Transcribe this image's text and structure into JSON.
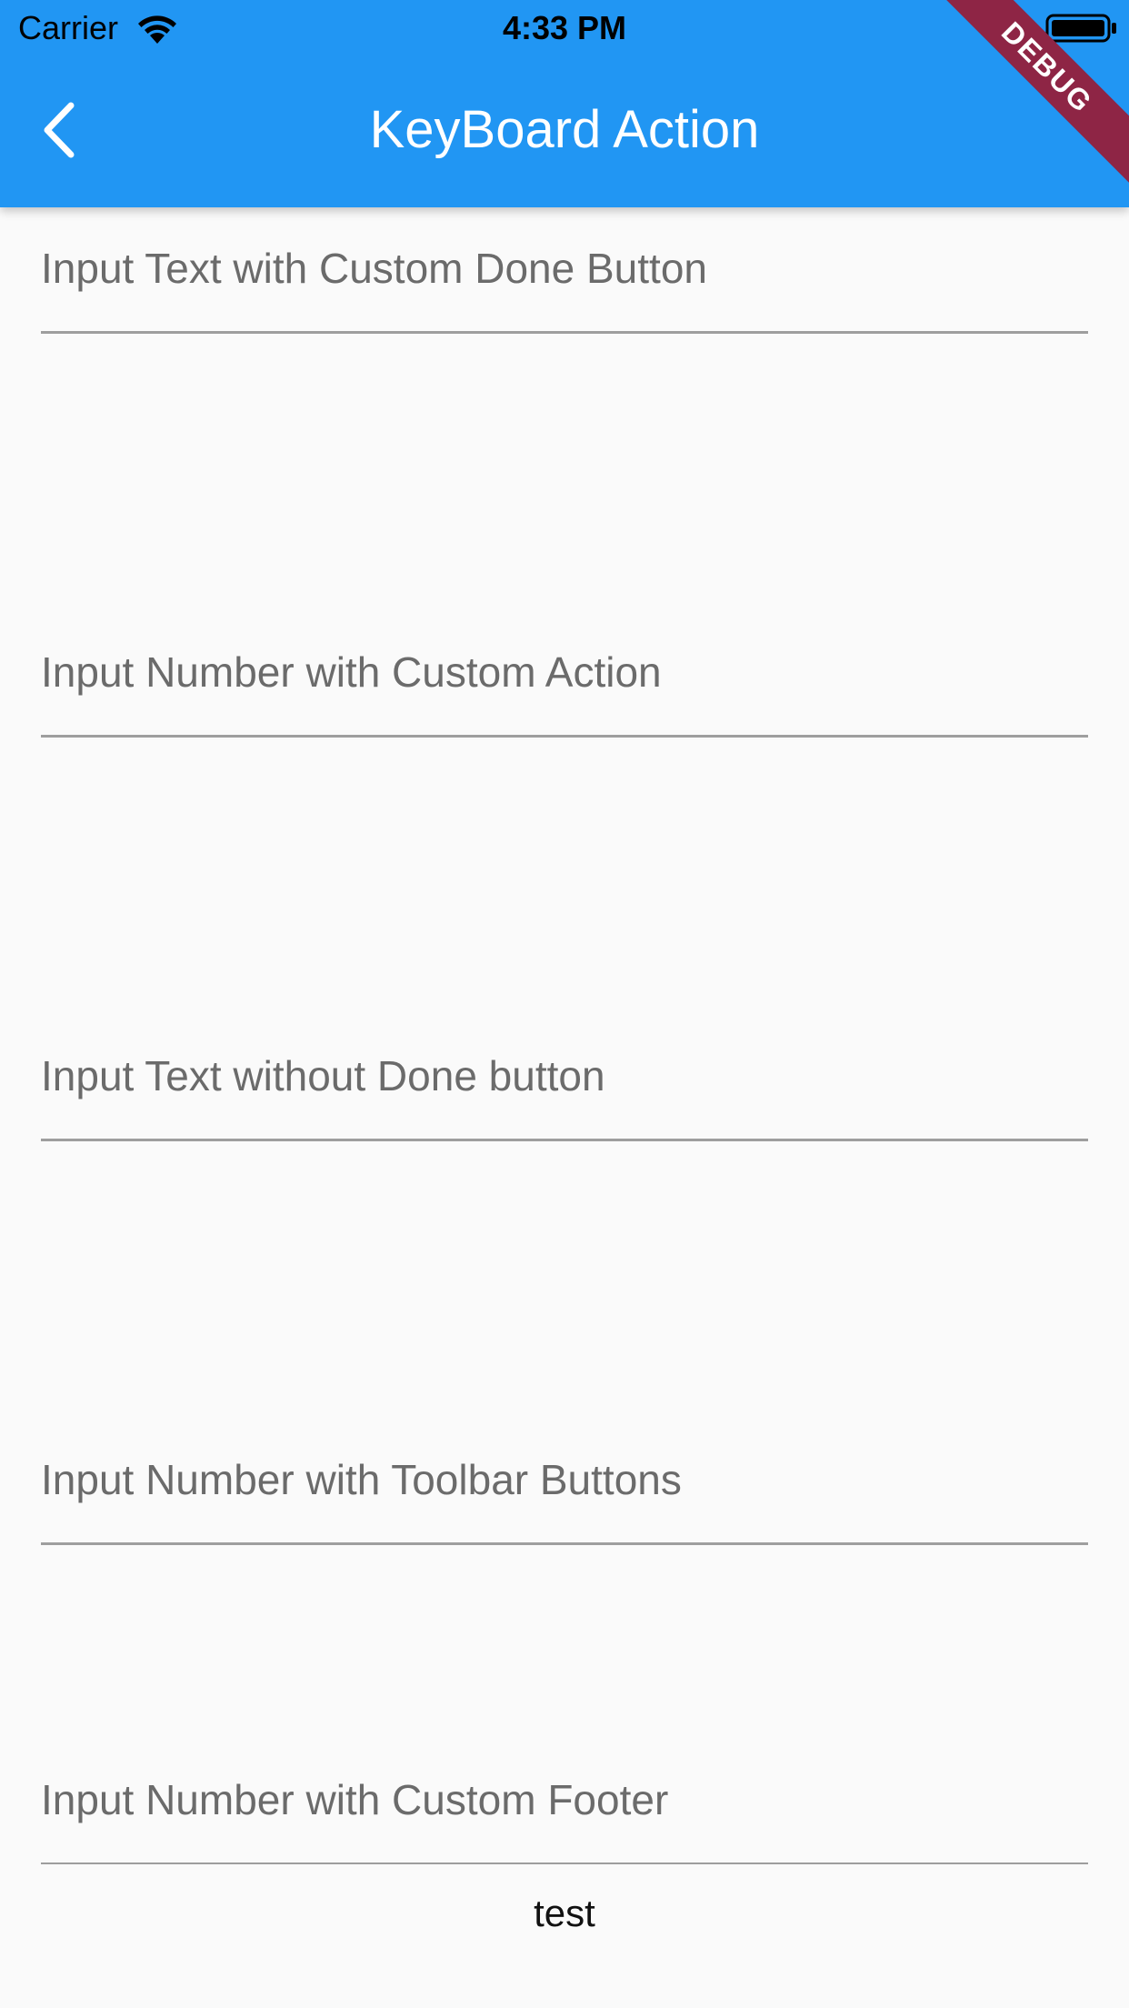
{
  "status_bar": {
    "carrier": "Carrier",
    "time": "4:33 PM",
    "wifi_icon": "wifi-icon",
    "battery_icon": "battery-full-icon"
  },
  "app_bar": {
    "title": "KeyBoard Action",
    "back_icon": "chevron-left-icon",
    "background_color": "#2196f3"
  },
  "debug_banner": "DEBUG",
  "fields": [
    {
      "placeholder": "Input Text with Custom Done Button",
      "value": ""
    },
    {
      "placeholder": "Input Number with Custom Action",
      "value": ""
    },
    {
      "placeholder": "Input Text without Done button",
      "value": ""
    },
    {
      "placeholder": "Input Number with Toolbar Buttons",
      "value": ""
    },
    {
      "placeholder": "Input Number with Custom Footer",
      "value": ""
    }
  ],
  "footer": {
    "text": "test"
  }
}
